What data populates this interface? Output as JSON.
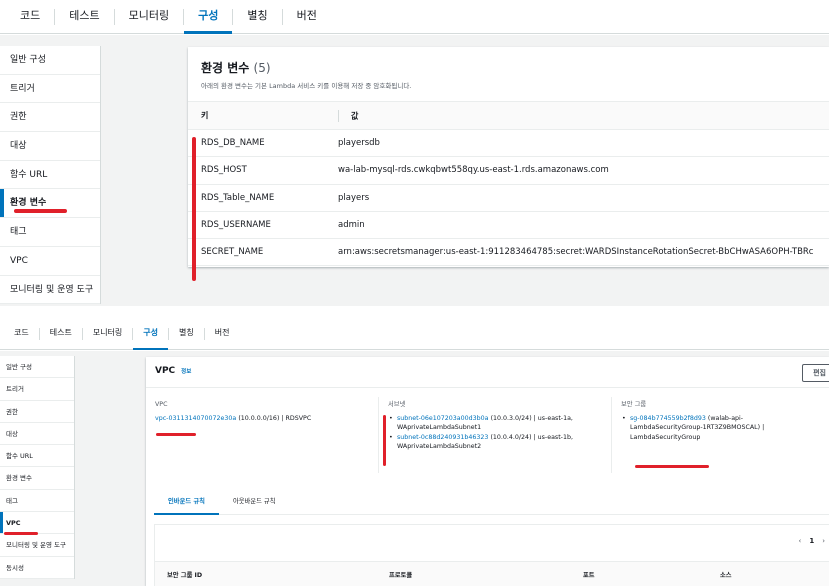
{
  "tabs": [
    "코드",
    "테스트",
    "모니터링",
    "구성",
    "별칭",
    "버전"
  ],
  "active_tab": "구성",
  "config_nav": [
    "일반 구성",
    "트리거",
    "권한",
    "대상",
    "함수 URL",
    "환경 변수",
    "태그",
    "VPC",
    "모니터링 및 운영 도구",
    "동시성"
  ],
  "env_section": {
    "title": "환경 변수",
    "count": "(5)",
    "description": "아래의 환경 변수는 기본 Lambda 서비스 키를 이용해 저장 중 암호화됩니다.",
    "columns": [
      "키",
      "값"
    ],
    "rows": [
      {
        "key": "RDS_DB_NAME",
        "value": "playersdb"
      },
      {
        "key": "RDS_HOST",
        "value": "wa-lab-mysql-rds.cwkqbwt558qy.us-east-1.rds.amazonaws.com"
      },
      {
        "key": "RDS_Table_NAME",
        "value": "players"
      },
      {
        "key": "RDS_USERNAME",
        "value": "admin"
      },
      {
        "key": "SECRET_NAME",
        "value": "arn:aws:secretsmanager:us-east-1:911283464785:secret:WARDSInstanceRotationSecret-BbCHwASA6OPH-TBRc"
      }
    ]
  },
  "vpc_section": {
    "title": "VPC",
    "info": "정보",
    "edit": "편집",
    "vpc_label": "VPC",
    "vpc_id": "vpc-0311314070072e30a",
    "vpc_detail": "(10.0.0.0/16) | RDSVPC",
    "subnet_label": "서브넷",
    "subnets": [
      {
        "id": "subnet-06e107203a00d3b0a",
        "detail": "(10.0.3.0/24) | us-east-1a,",
        "name": "WAprivateLambdaSubnet1"
      },
      {
        "id": "subnet-0c88d240931b46323",
        "detail": "(10.0.4.0/24) | us-east-1b,",
        "name": "WAprivateLambdaSubnet2"
      }
    ],
    "sg_label": "보안 그룹",
    "security_group": {
      "id": "sg-084b774559b2f8d93",
      "detail": "(walab-api-",
      "name": "LambdaSecurityGroup-1RT3Z9BMOSCAL) |",
      "name2": "LambdaSecurityGroup"
    },
    "rule_tabs": [
      "인바운드 규칙",
      "아웃바운드 규칙"
    ],
    "pager": {
      "prev": "‹",
      "page": "1",
      "next": "›"
    },
    "rule_columns": [
      "보안 그룹 ID",
      "프로토콜",
      "포트",
      "소스"
    ]
  },
  "colors": {
    "accent": "#0073bb",
    "annotation": "#e0202a"
  }
}
